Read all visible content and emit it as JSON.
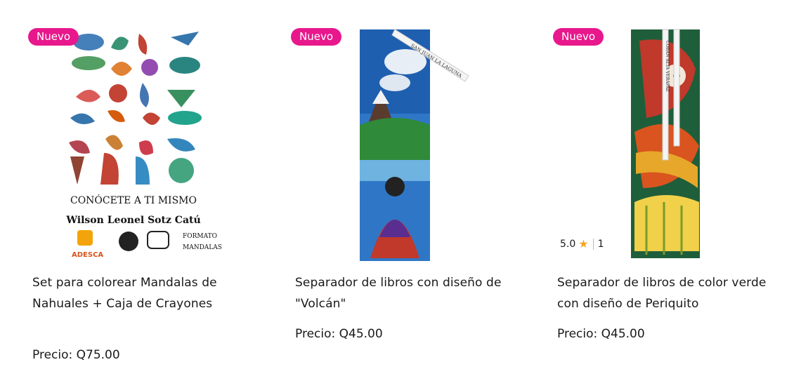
{
  "products": [
    {
      "badge": "Nuevo",
      "title": "Set para colorear Mandalas de Nahuales + Caja de Crayones",
      "price": "Precio: Q75.00",
      "cover": {
        "title": "CONÓCETE A TI MISMO",
        "author": "Wilson Leonel Sotz Catú",
        "logo1": "ADESCA",
        "format_line1": "FORMATO",
        "format_line2": "MANDALAS"
      }
    },
    {
      "badge": "Nuevo",
      "title": "Separador de libros con diseño de \"Volcán\"",
      "price": "Precio: Q45.00",
      "ribbon_text": "SAN JUAN LA LAGUNA"
    },
    {
      "badge": "Nuevo",
      "title": "Separador de libros de color verde con diseño de Periquito",
      "price": "Precio: Q45.00",
      "ribbon_text": "COBÁN ALTA VERAPAZ",
      "rating": {
        "score": "5.0",
        "count": "1",
        "icon": "star-icon"
      }
    }
  ],
  "colors": {
    "badge": "#e8188c",
    "star": "#f5a623"
  }
}
